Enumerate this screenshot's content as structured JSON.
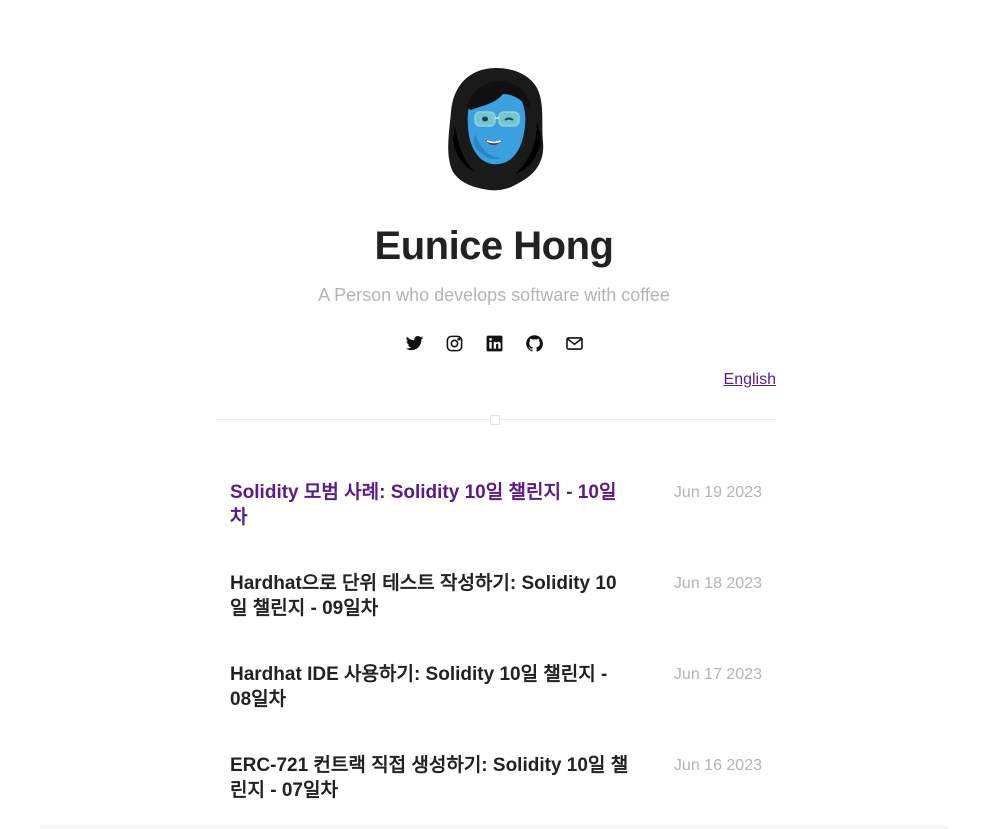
{
  "profile": {
    "name": "Eunice Hong",
    "tagline": "A Person who develops software with coffee"
  },
  "social": [
    {
      "icon": "twitter-icon"
    },
    {
      "icon": "instagram-icon"
    },
    {
      "icon": "linkedin-icon"
    },
    {
      "icon": "github-icon"
    },
    {
      "icon": "mail-icon"
    }
  ],
  "language_link": "English",
  "posts": [
    {
      "title": "Solidity 모범 사례: Solidity 10일 챌린지 - 10일차",
      "date": "Jun 19 2023",
      "visited": true
    },
    {
      "title": "Hardhat으로 단위 테스트 작성하기: Solidity 10일 챌린지 - 09일차",
      "date": "Jun 18 2023",
      "visited": false
    },
    {
      "title": "Hardhat IDE 사용하기: Solidity 10일 챌린지 - 08일차",
      "date": "Jun 17 2023",
      "visited": false
    },
    {
      "title": "ERC-721 컨트랙 직접 생성하기: Solidity 10일 챌린지 - 07일차",
      "date": "Jun 16 2023",
      "visited": false
    }
  ],
  "colors": {
    "visited_link": "#5a1a8a",
    "muted": "#b4b4b4",
    "text": "#222222"
  }
}
